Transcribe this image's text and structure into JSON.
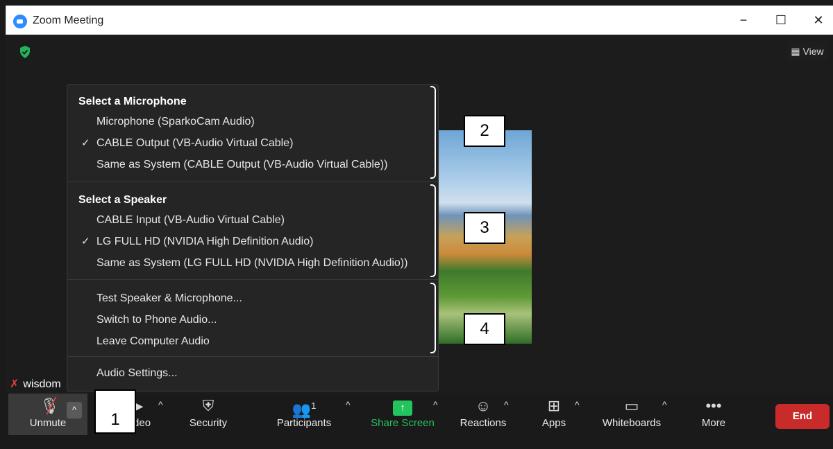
{
  "window": {
    "title": "Zoom Meeting",
    "minimize": "−",
    "maximize": "☐",
    "close": "✕"
  },
  "meeting": {
    "view_label": "View",
    "participant_name": "wisdom"
  },
  "audio_menu": {
    "microphone_header": "Select a Microphone",
    "microphones": [
      {
        "label": "Microphone (SparkoCam Audio)",
        "checked": false
      },
      {
        "label": "CABLE Output (VB-Audio Virtual Cable)",
        "checked": true
      },
      {
        "label": "Same as System (CABLE Output (VB-Audio Virtual Cable))",
        "checked": false
      }
    ],
    "speaker_header": "Select a Speaker",
    "speakers": [
      {
        "label": "CABLE Input (VB-Audio Virtual Cable)",
        "checked": false
      },
      {
        "label": "LG FULL HD (NVIDIA High Definition Audio)",
        "checked": true
      },
      {
        "label": "Same as System (LG FULL HD (NVIDIA High Definition Audio))",
        "checked": false
      }
    ],
    "actions": [
      "Test Speaker & Microphone...",
      "Switch to Phone Audio...",
      "Leave Computer Audio"
    ],
    "settings": "Audio Settings..."
  },
  "toolbar": {
    "unmute": "Unmute",
    "video": "Video",
    "security": "Security",
    "participants": "Participants",
    "participant_count": "1",
    "share_screen": "Share Screen",
    "reactions": "Reactions",
    "apps": "Apps",
    "whiteboards": "Whiteboards",
    "more": "More",
    "end": "End"
  },
  "callouts": [
    "1",
    "2",
    "3",
    "4"
  ],
  "colors": {
    "end_button": "#c92b2b",
    "share_screen": "#23c45e",
    "security_shield": "#23b35a",
    "muted_mic": "#e04040"
  }
}
